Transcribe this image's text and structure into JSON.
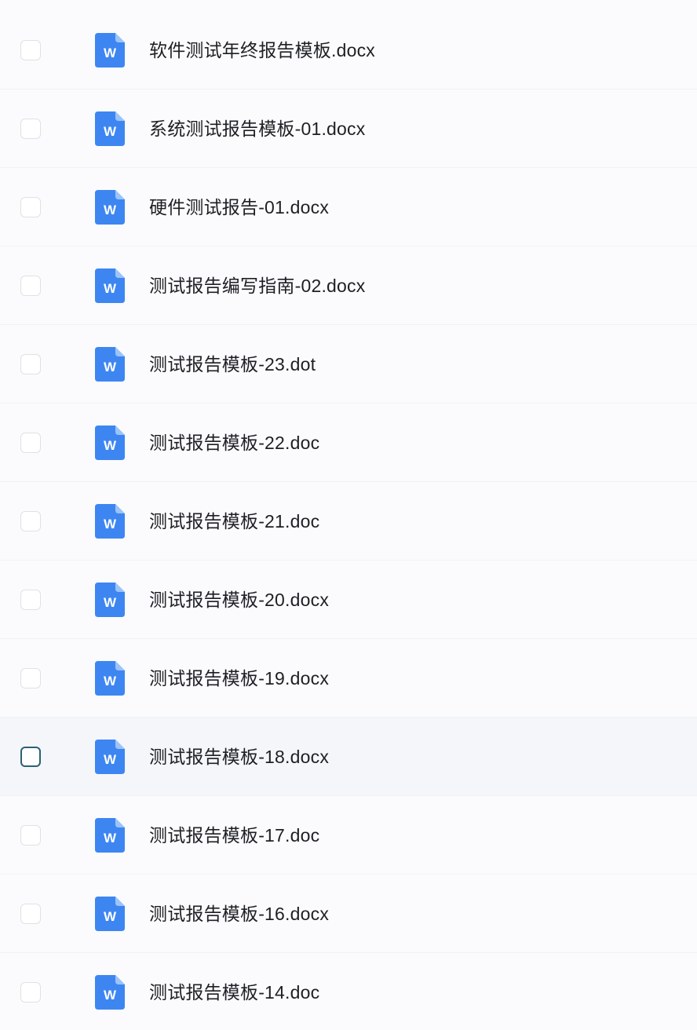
{
  "files": [
    {
      "name": "软件测试年终报告模板.docx",
      "icon": "word-document-icon",
      "checked": false,
      "hovered": false
    },
    {
      "name": "系统测试报告模板-01.docx",
      "icon": "word-document-icon",
      "checked": false,
      "hovered": false
    },
    {
      "name": "硬件测试报告-01.docx",
      "icon": "word-document-icon",
      "checked": false,
      "hovered": false
    },
    {
      "name": "测试报告编写指南-02.docx",
      "icon": "word-document-icon",
      "checked": false,
      "hovered": false
    },
    {
      "name": "测试报告模板-23.dot",
      "icon": "word-document-icon",
      "checked": false,
      "hovered": false
    },
    {
      "name": "测试报告模板-22.doc",
      "icon": "word-document-icon",
      "checked": false,
      "hovered": false
    },
    {
      "name": "测试报告模板-21.doc",
      "icon": "word-document-icon",
      "checked": false,
      "hovered": false
    },
    {
      "name": "测试报告模板-20.docx",
      "icon": "word-document-icon",
      "checked": false,
      "hovered": false
    },
    {
      "name": "测试报告模板-19.docx",
      "icon": "word-document-icon",
      "checked": false,
      "hovered": false
    },
    {
      "name": "测试报告模板-18.docx",
      "icon": "word-document-icon",
      "checked": false,
      "hovered": true
    },
    {
      "name": "测试报告模板-17.doc",
      "icon": "word-document-icon",
      "checked": false,
      "hovered": false
    },
    {
      "name": "测试报告模板-16.docx",
      "icon": "word-document-icon",
      "checked": false,
      "hovered": false
    },
    {
      "name": "测试报告模板-14.doc",
      "icon": "word-document-icon",
      "checked": false,
      "hovered": false
    }
  ],
  "colors": {
    "icon_blue": "#3d86f2",
    "icon_fold": "#9cc4fa",
    "hover_checkbox_border": "#2a6273",
    "text": "#1e1f24"
  }
}
